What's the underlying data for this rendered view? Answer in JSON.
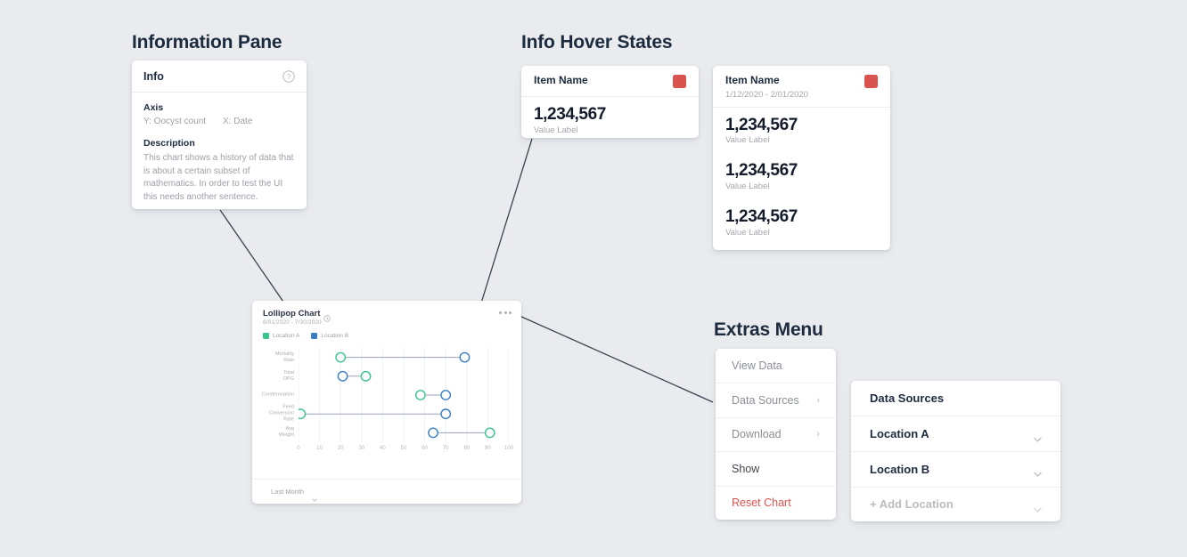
{
  "sections": {
    "information_pane": "Information Pane",
    "info_hover_states": "Info Hover States",
    "extras_menu": "Extras Menu"
  },
  "info_pane": {
    "title": "Info",
    "help_icon": "question-circle-icon",
    "axis_heading": "Axis",
    "axis_y": "Y: Oocyst count",
    "axis_x": "X: Date",
    "description_heading": "Description",
    "description": "This chart shows a history of data that is about a certain subset of mathematics. In order to test the UI this needs another sentence."
  },
  "hover_cards": [
    {
      "name": "Item Name",
      "date_range": "",
      "swatch_color": "#d9534f",
      "values": [
        {
          "value": "1,234,567",
          "label": "Value Label"
        }
      ]
    },
    {
      "name": "Item Name",
      "date_range": "1/12/2020 - 2/01/2020",
      "swatch_color": "#d9534f",
      "values": [
        {
          "value": "1,234,567",
          "label": "Value Label"
        },
        {
          "value": "1,234,567",
          "label": "Value Label"
        },
        {
          "value": "1,234,567",
          "label": "Value Label"
        }
      ]
    }
  ],
  "chart_card": {
    "title": "Lollipop Chart",
    "clock_icon": "clock-icon",
    "date_range": "6/01/2020 - 7/30/2020",
    "overflow_icon": "ellipsis-icon",
    "footer_select": "Last Month",
    "footer_caret_icon": "chevron-down-icon"
  },
  "chart_data": {
    "type": "bar",
    "title": "Lollipop Chart",
    "subtitle": "6/01/2020 - 7/30/2020",
    "xlabel": "",
    "ylabel": "",
    "xlim": [
      0,
      100
    ],
    "xticks": [
      0,
      10,
      20,
      30,
      40,
      50,
      60,
      70,
      80,
      90,
      100
    ],
    "grid": true,
    "legend_position": "top-left",
    "categories": [
      "Mortality Rate",
      "Total OPG",
      "Condemnation",
      "Feed Conversion Rate",
      "Avg Weight"
    ],
    "series": [
      {
        "name": "Location A",
        "color": "#3cc48c",
        "values": [
          20,
          32,
          58,
          1,
          91
        ]
      },
      {
        "name": "Location B",
        "color": "#3a7ec4",
        "values": [
          79,
          21,
          70,
          70,
          64
        ]
      }
    ]
  },
  "extras_menu": {
    "items": [
      {
        "label": "View Data",
        "has_submenu": false,
        "style": "normal"
      },
      {
        "label": "Data Sources",
        "has_submenu": true,
        "style": "normal"
      },
      {
        "label": "Download",
        "has_submenu": true,
        "style": "normal"
      },
      {
        "label": "Show",
        "has_submenu": false,
        "style": "dark"
      },
      {
        "label": "Reset Chart",
        "has_submenu": false,
        "style": "danger"
      }
    ],
    "submenu_caret": "›"
  },
  "data_sources": {
    "title": "Data Sources",
    "rows": [
      {
        "label": "Location A",
        "muted": false
      },
      {
        "label": "Location B",
        "muted": false
      },
      {
        "label": "+ Add Location",
        "muted": true
      }
    ],
    "caret_icon": "caret-down-icon"
  }
}
